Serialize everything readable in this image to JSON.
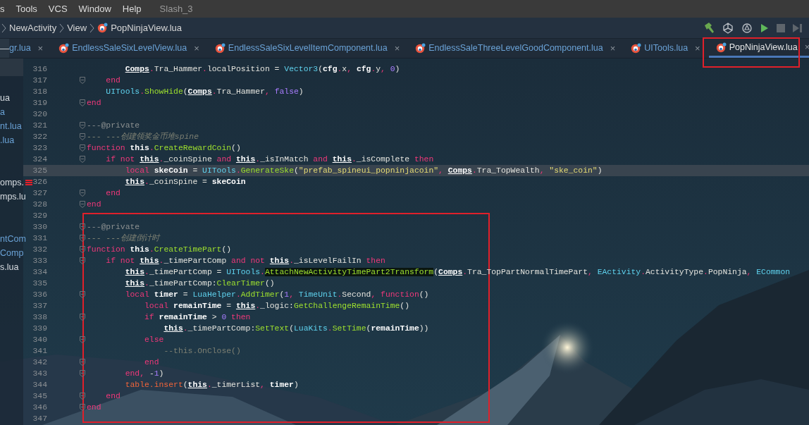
{
  "menu": [
    {
      "label": "s"
    },
    {
      "label": "Tools"
    },
    {
      "label": "VCS"
    },
    {
      "label": "Window"
    },
    {
      "label": "Help"
    }
  ],
  "project_title": "Slash_3",
  "breadcrumb": [
    "NewActivity",
    "View",
    "PopNinjaView.lua"
  ],
  "tabs": [
    {
      "label": "gr.lua",
      "close": "×",
      "selected": false
    },
    {
      "label": "EndlessSaleSixLevelView.lua",
      "close": "×",
      "icon": true,
      "selected": false
    },
    {
      "label": "EndlessSaleSixLevelItemComponent.lua",
      "close": "×",
      "icon": true,
      "selected": false
    },
    {
      "label": "EndlessSaleThreeLevelGoodComponent.lua",
      "close": "×",
      "icon": true,
      "selected": false
    },
    {
      "label": "UITools.lua",
      "close": "×",
      "icon": true,
      "selected": false
    },
    {
      "label": "PopNinjaView.lua",
      "close": "×",
      "icon": true,
      "selected": true,
      "outlined": true
    }
  ],
  "collapse_button": "—",
  "project_tree": [
    {
      "label": "ua",
      "linked": false
    },
    {
      "label": "a",
      "linked": true
    },
    {
      "label": "nt.lua",
      "linked": true
    },
    {
      "label": ".lua",
      "linked": true
    },
    {
      "label": "omps.",
      "linked": false,
      "error": true
    },
    {
      "label": "mps.lu",
      "linked": false
    },
    {
      "label": "ntCom",
      "linked": true
    },
    {
      "label": "Comp",
      "linked": true
    },
    {
      "label": "s.lua",
      "linked": false
    }
  ],
  "code_sections": [
    {
      "lines": [
        {
          "number": "316",
          "tokens": [
            {
              "kind": "ref",
              "text": "        Comps"
            },
            {
              "kind": "pun",
              "text": "."
            },
            {
              "kind": "p",
              "text": "Tra_Hammer"
            },
            {
              "kind": "pun",
              "text": "."
            },
            {
              "kind": "p",
              "text": "localPosition = "
            },
            {
              "kind": "cls",
              "text": "Vector3"
            },
            {
              "kind": "p",
              "text": "("
            },
            {
              "kind": "b",
              "text": "cfg"
            },
            {
              "kind": "pun",
              "text": "."
            },
            {
              "kind": "p",
              "text": "x"
            },
            {
              "kind": "pun",
              "text": ", "
            },
            {
              "kind": "b",
              "text": "cfg"
            },
            {
              "kind": "pun",
              "text": "."
            },
            {
              "kind": "p",
              "text": "y"
            },
            {
              "kind": "pun",
              "text": ", "
            },
            {
              "kind": "const",
              "text": "0"
            },
            {
              "kind": "p",
              "text": ")"
            }
          ]
        },
        {
          "number": "317",
          "fold": true,
          "tokens": [
            {
              "kind": "kw",
              "text": "    end"
            }
          ]
        },
        {
          "number": "318",
          "tokens": [
            {
              "kind": "cls",
              "text": "    UITools"
            },
            {
              "kind": "pun",
              "text": "."
            },
            {
              "kind": "fn",
              "text": "ShowHide"
            },
            {
              "kind": "p",
              "text": "("
            },
            {
              "kind": "ref",
              "text": "Comps"
            },
            {
              "kind": "pun",
              "text": "."
            },
            {
              "kind": "p",
              "text": "Tra_Hammer"
            },
            {
              "kind": "pun",
              "text": ", "
            },
            {
              "kind": "const",
              "text": "false"
            },
            {
              "kind": "p",
              "text": ")"
            }
          ]
        },
        {
          "number": "319",
          "fold": true,
          "tokens": [
            {
              "kind": "kw",
              "text": "end"
            }
          ]
        },
        {
          "number": "320"
        },
        {
          "number": "321",
          "fold": true,
          "tokens": [
            {
              "kind": "doc",
              "text": "---@private"
            }
          ]
        },
        {
          "number": "322",
          "fold": true,
          "tokens": [
            {
              "kind": "cmti",
              "text": "--- ---创建领奖金币堆spine"
            }
          ]
        },
        {
          "number": "323",
          "fold": true,
          "tokens": [
            {
              "kind": "kw",
              "text": "function "
            },
            {
              "kind": "b",
              "text": "this"
            },
            {
              "kind": "pun",
              "text": "."
            },
            {
              "kind": "fn",
              "text": "CreateRewardCoin"
            },
            {
              "kind": "p",
              "text": "()"
            }
          ]
        },
        {
          "number": "324",
          "fold": true,
          "tokens": [
            {
              "kind": "kw",
              "text": "    if not "
            },
            {
              "kind": "ref",
              "text": "this"
            },
            {
              "kind": "pun",
              "text": "."
            },
            {
              "kind": "p",
              "text": "_coinSpine "
            },
            {
              "kind": "kw",
              "text": "and "
            },
            {
              "kind": "ref",
              "text": "this"
            },
            {
              "kind": "pun",
              "text": "."
            },
            {
              "kind": "p",
              "text": "_isInMatch "
            },
            {
              "kind": "kw",
              "text": "and "
            },
            {
              "kind": "ref",
              "text": "this"
            },
            {
              "kind": "pun",
              "text": "."
            },
            {
              "kind": "p",
              "text": "_isComplete "
            },
            {
              "kind": "kw",
              "text": "then"
            }
          ]
        },
        {
          "number": "325",
          "current": true,
          "tokens": [
            {
              "kind": "kw",
              "text": "        local "
            },
            {
              "kind": "b",
              "text": "skeCoin"
            },
            {
              "kind": "p",
              "text": " = "
            },
            {
              "kind": "cls",
              "text": "UITools"
            },
            {
              "kind": "pun",
              "text": "."
            },
            {
              "kind": "fn",
              "text": "GenerateSke"
            },
            {
              "kind": "p",
              "text": "("
            },
            {
              "kind": "str",
              "text": "\"prefab_spineui_popninjacoin\""
            },
            {
              "kind": "pun",
              "text": ", "
            },
            {
              "kind": "ref",
              "text": "Comps"
            },
            {
              "kind": "pun",
              "text": "."
            },
            {
              "kind": "p",
              "text": "Tra_TopWealth"
            },
            {
              "kind": "pun",
              "text": ", "
            },
            {
              "kind": "str",
              "text": "\"ske_coin\""
            },
            {
              "kind": "p",
              "text": ")"
            }
          ]
        },
        {
          "number": "326",
          "tokens": [
            {
              "kind": "ref",
              "text": "        this"
            },
            {
              "kind": "pun",
              "text": "."
            },
            {
              "kind": "p",
              "text": "_coinSpine = "
            },
            {
              "kind": "b",
              "text": "skeCoin"
            }
          ]
        },
        {
          "number": "327",
          "fold": true,
          "tokens": [
            {
              "kind": "kw",
              "text": "    end"
            }
          ]
        },
        {
          "number": "328",
          "fold": true,
          "tokens": [
            {
              "kind": "kw",
              "text": "end"
            }
          ]
        }
      ]
    },
    {
      "framed": true,
      "lines": [
        {
          "number": "329"
        },
        {
          "number": "330",
          "fold": true,
          "tokens": [
            {
              "kind": "doc",
              "text": "---@private"
            }
          ]
        },
        {
          "number": "331",
          "fold": true,
          "tokens": [
            {
              "kind": "cmti",
              "text": "--- ---创建倒计时"
            }
          ]
        },
        {
          "number": "332",
          "fold": true,
          "tokens": [
            {
              "kind": "kw",
              "text": "function "
            },
            {
              "kind": "b",
              "text": "this"
            },
            {
              "kind": "pun",
              "text": "."
            },
            {
              "kind": "fn",
              "text": "CreateTimePart"
            },
            {
              "kind": "p",
              "text": "()"
            }
          ]
        },
        {
          "number": "333",
          "fold": true,
          "tokens": [
            {
              "kind": "kw",
              "text": "    if not "
            },
            {
              "kind": "ref",
              "text": "this"
            },
            {
              "kind": "pun",
              "text": "."
            },
            {
              "kind": "p",
              "text": "_timePartComp "
            },
            {
              "kind": "kw",
              "text": "and not "
            },
            {
              "kind": "ref",
              "text": "this"
            },
            {
              "kind": "pun",
              "text": "."
            },
            {
              "kind": "p",
              "text": "_isLevelFailIn "
            },
            {
              "kind": "kw",
              "text": "then"
            }
          ]
        },
        {
          "number": "334",
          "tokens": [
            {
              "kind": "ref",
              "text": "        this"
            },
            {
              "kind": "pun",
              "text": "."
            },
            {
              "kind": "p",
              "text": "_timePartComp = "
            },
            {
              "kind": "cls",
              "text": "UITools"
            },
            {
              "kind": "pun",
              "text": "."
            },
            {
              "kind": "match",
              "text": "AttachNewActivityTimePart2Transform"
            },
            {
              "kind": "p",
              "text": "("
            },
            {
              "kind": "ref",
              "text": "Comps"
            },
            {
              "kind": "pun",
              "text": "."
            },
            {
              "kind": "p",
              "text": "Tra_TopPartNormalTimePart"
            },
            {
              "kind": "pun",
              "text": ", "
            },
            {
              "kind": "cls",
              "text": "EActivity"
            },
            {
              "kind": "pun",
              "text": "."
            },
            {
              "kind": "p",
              "text": "ActivityType"
            },
            {
              "kind": "pun",
              "text": "."
            },
            {
              "kind": "p",
              "text": "PopNinja"
            },
            {
              "kind": "pun",
              "text": ", "
            },
            {
              "kind": "cls",
              "text": "ECommon"
            }
          ]
        },
        {
          "number": "335",
          "tokens": [
            {
              "kind": "ref",
              "text": "        this"
            },
            {
              "kind": "pun",
              "text": "."
            },
            {
              "kind": "p",
              "text": "_timePartComp:"
            },
            {
              "kind": "fn",
              "text": "ClearTimer"
            },
            {
              "kind": "p",
              "text": "()"
            }
          ]
        },
        {
          "number": "336",
          "fold": true,
          "tokens": [
            {
              "kind": "kw",
              "text": "        local "
            },
            {
              "kind": "b",
              "text": "timer"
            },
            {
              "kind": "p",
              "text": " = "
            },
            {
              "kind": "cls",
              "text": "LuaHelper"
            },
            {
              "kind": "pun",
              "text": "."
            },
            {
              "kind": "fn",
              "text": "AddTimer"
            },
            {
              "kind": "p",
              "text": "("
            },
            {
              "kind": "const",
              "text": "1"
            },
            {
              "kind": "pun",
              "text": ", "
            },
            {
              "kind": "cls",
              "text": "TimeUnit"
            },
            {
              "kind": "pun",
              "text": "."
            },
            {
              "kind": "p",
              "text": "Second"
            },
            {
              "kind": "pun",
              "text": ", "
            },
            {
              "kind": "kw",
              "text": "function"
            },
            {
              "kind": "p",
              "text": "()"
            }
          ]
        },
        {
          "number": "337",
          "tokens": [
            {
              "kind": "kw",
              "text": "            local "
            },
            {
              "kind": "b",
              "text": "remainTime"
            },
            {
              "kind": "p",
              "text": " = "
            },
            {
              "kind": "ref",
              "text": "this"
            },
            {
              "kind": "pun",
              "text": "."
            },
            {
              "kind": "p",
              "text": "_logic:"
            },
            {
              "kind": "fn",
              "text": "GetChallengeRemainTime"
            },
            {
              "kind": "p",
              "text": "()"
            }
          ]
        },
        {
          "number": "338",
          "fold": true,
          "tokens": [
            {
              "kind": "kw",
              "text": "            if "
            },
            {
              "kind": "b",
              "text": "remainTime"
            },
            {
              "kind": "p",
              "text": " > "
            },
            {
              "kind": "const",
              "text": "0"
            },
            {
              "kind": "kw",
              "text": " then"
            }
          ]
        },
        {
          "number": "339",
          "tokens": [
            {
              "kind": "ref",
              "text": "                this"
            },
            {
              "kind": "pun",
              "text": "."
            },
            {
              "kind": "p",
              "text": "_timePartComp:"
            },
            {
              "kind": "fn",
              "text": "SetText"
            },
            {
              "kind": "p",
              "text": "("
            },
            {
              "kind": "cls",
              "text": "LuaKits"
            },
            {
              "kind": "pun",
              "text": "."
            },
            {
              "kind": "fn",
              "text": "SetTime"
            },
            {
              "kind": "p",
              "text": "("
            },
            {
              "kind": "b",
              "text": "remainTime"
            },
            {
              "kind": "p",
              "text": "))"
            }
          ]
        },
        {
          "number": "340",
          "fold": true,
          "tokens": [
            {
              "kind": "kw",
              "text": "            else"
            }
          ]
        },
        {
          "number": "341",
          "tokens": [
            {
              "kind": "cmt",
              "text": "                --this.OnClose()"
            }
          ]
        },
        {
          "number": "342",
          "fold": true,
          "tokens": [
            {
              "kind": "kw",
              "text": "            end"
            }
          ]
        },
        {
          "number": "343",
          "fold": true,
          "tokens": [
            {
              "kind": "kw",
              "text": "        end"
            },
            {
              "kind": "pun",
              "text": ", "
            },
            {
              "kind": "p",
              "text": "-"
            },
            {
              "kind": "const",
              "text": "1"
            },
            {
              "kind": "p",
              "text": ")"
            }
          ]
        },
        {
          "number": "344",
          "tokens": [
            {
              "kind": "lib",
              "text": "        table.insert"
            },
            {
              "kind": "p",
              "text": "("
            },
            {
              "kind": "ref",
              "text": "this"
            },
            {
              "kind": "pun",
              "text": "."
            },
            {
              "kind": "p",
              "text": "_timerList"
            },
            {
              "kind": "pun",
              "text": ", "
            },
            {
              "kind": "b",
              "text": "timer"
            },
            {
              "kind": "p",
              "text": ")"
            }
          ]
        },
        {
          "number": "345",
          "fold": true,
          "tokens": [
            {
              "kind": "kw",
              "text": "    end"
            }
          ]
        },
        {
          "number": "346",
          "fold": true,
          "tokens": [
            {
              "kind": "kw",
              "text": "end"
            }
          ]
        },
        {
          "number": "347"
        }
      ]
    }
  ]
}
